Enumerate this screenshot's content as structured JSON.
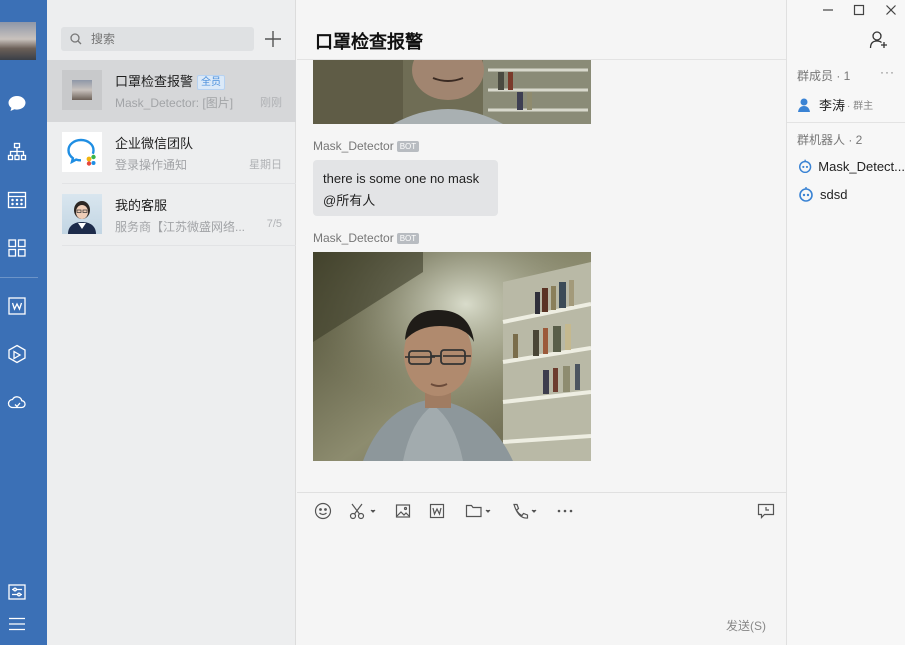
{
  "rail": {
    "icons": [
      "chat-icon",
      "contacts-icon",
      "calendar-icon",
      "apps-icon",
      "doc-icon",
      "workspace-icon",
      "cloud-icon",
      "settings-icon",
      "menu-icon"
    ]
  },
  "search": {
    "placeholder": "搜索"
  },
  "conversations": [
    {
      "name": "口罩检查报警",
      "badge": "全员",
      "preview": "Mask_Detector: [图片]",
      "time": "刚刚"
    },
    {
      "name": "企业微信团队",
      "preview": "登录操作通知",
      "time": "星期日"
    },
    {
      "name": "我的客服",
      "preview": "服务商【江苏微盛网络...",
      "time": "7/5"
    }
  ],
  "chat": {
    "title": "口罩检查报警",
    "messages": [
      {
        "sender": "Mask_Detector",
        "tag": "BOT",
        "text_line1": "there is some one no mask",
        "text_line2": "@所有人"
      },
      {
        "sender": "Mask_Detector",
        "tag": "BOT"
      }
    ],
    "send_label": "发送(S)"
  },
  "members": {
    "members_header": "群成员 · 1",
    "owner_name": "李涛",
    "owner_role": "· 群主",
    "bots_header": "群机器人 · 2",
    "bots": [
      "Mask_Detect...",
      "sdsd"
    ],
    "more": "···"
  },
  "colors": {
    "rail": "#3b70b6",
    "accent": "#3a83d4",
    "bubble": "#e3e4e6"
  }
}
